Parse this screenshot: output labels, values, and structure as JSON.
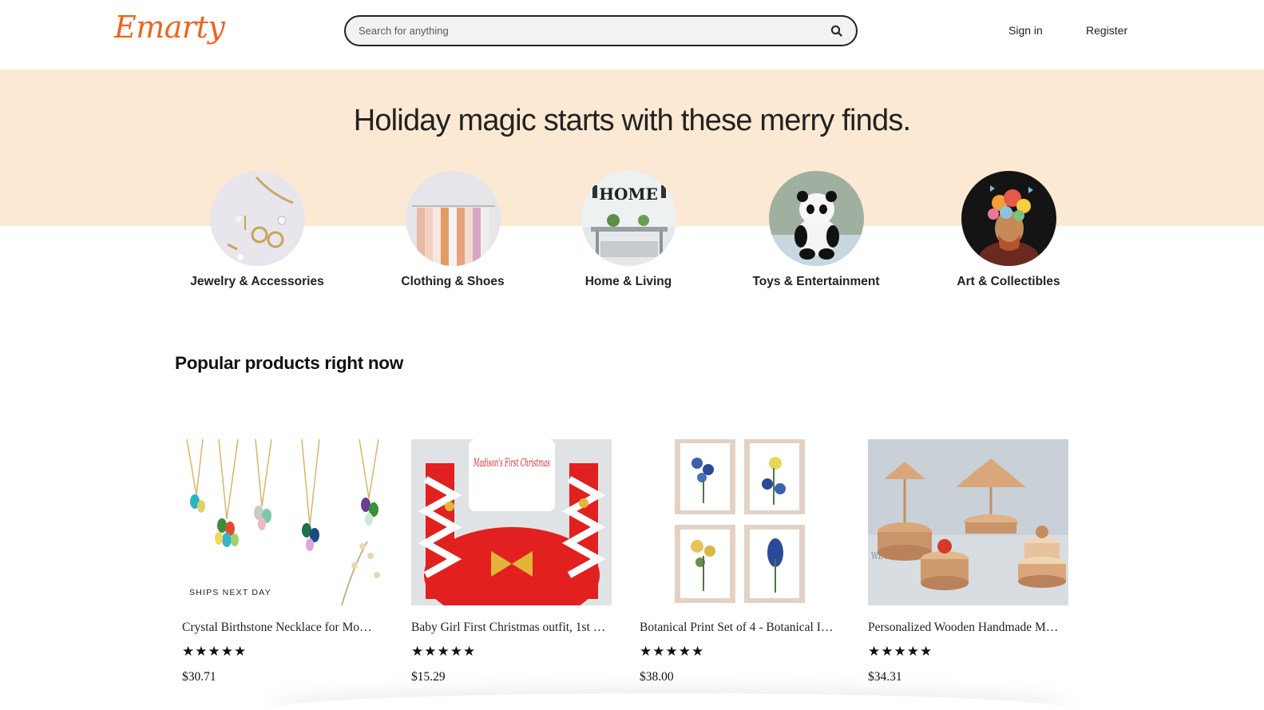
{
  "header": {
    "logo": "Emarty",
    "search_placeholder": "Search for anything",
    "search_icon": "search-icon",
    "sign_in": "Sign in",
    "register": "Register"
  },
  "banner": {
    "title": "Holiday magic starts with these merry finds."
  },
  "categories": [
    {
      "label": "Jewelry & Accessories"
    },
    {
      "label": "Clothing & Shoes"
    },
    {
      "label": "Home & Living",
      "image_text": "HOME"
    },
    {
      "label": "Toys & Entertainment"
    },
    {
      "label": "Art & Collectibles"
    }
  ],
  "popular": {
    "title": "Popular products right now",
    "products": [
      {
        "title": "Crystal Birthstone Necklace for Mo…",
        "rating_stars": "★★★★★",
        "rating": 5,
        "price": "$30.71",
        "badge": "SHIPS NEXT DAY"
      },
      {
        "title": "Baby Girl First Christmas outfit, 1st …",
        "rating_stars": "★★★★★",
        "rating": 5,
        "price": "$15.29",
        "image_text": "Madison's First Christmas"
      },
      {
        "title": "Botanical Print Set of 4 - Botanical I…",
        "rating_stars": "★★★★★",
        "rating": 5,
        "price": "$38.00"
      },
      {
        "title": "Personalized Wooden Handmade M…",
        "rating_stars": "★★★★★",
        "rating": 5,
        "price": "$34.31",
        "image_text": "WE ALL SAID"
      }
    ]
  },
  "colors": {
    "brand": "#f1641e",
    "banner_bg": "#fce9d3"
  }
}
